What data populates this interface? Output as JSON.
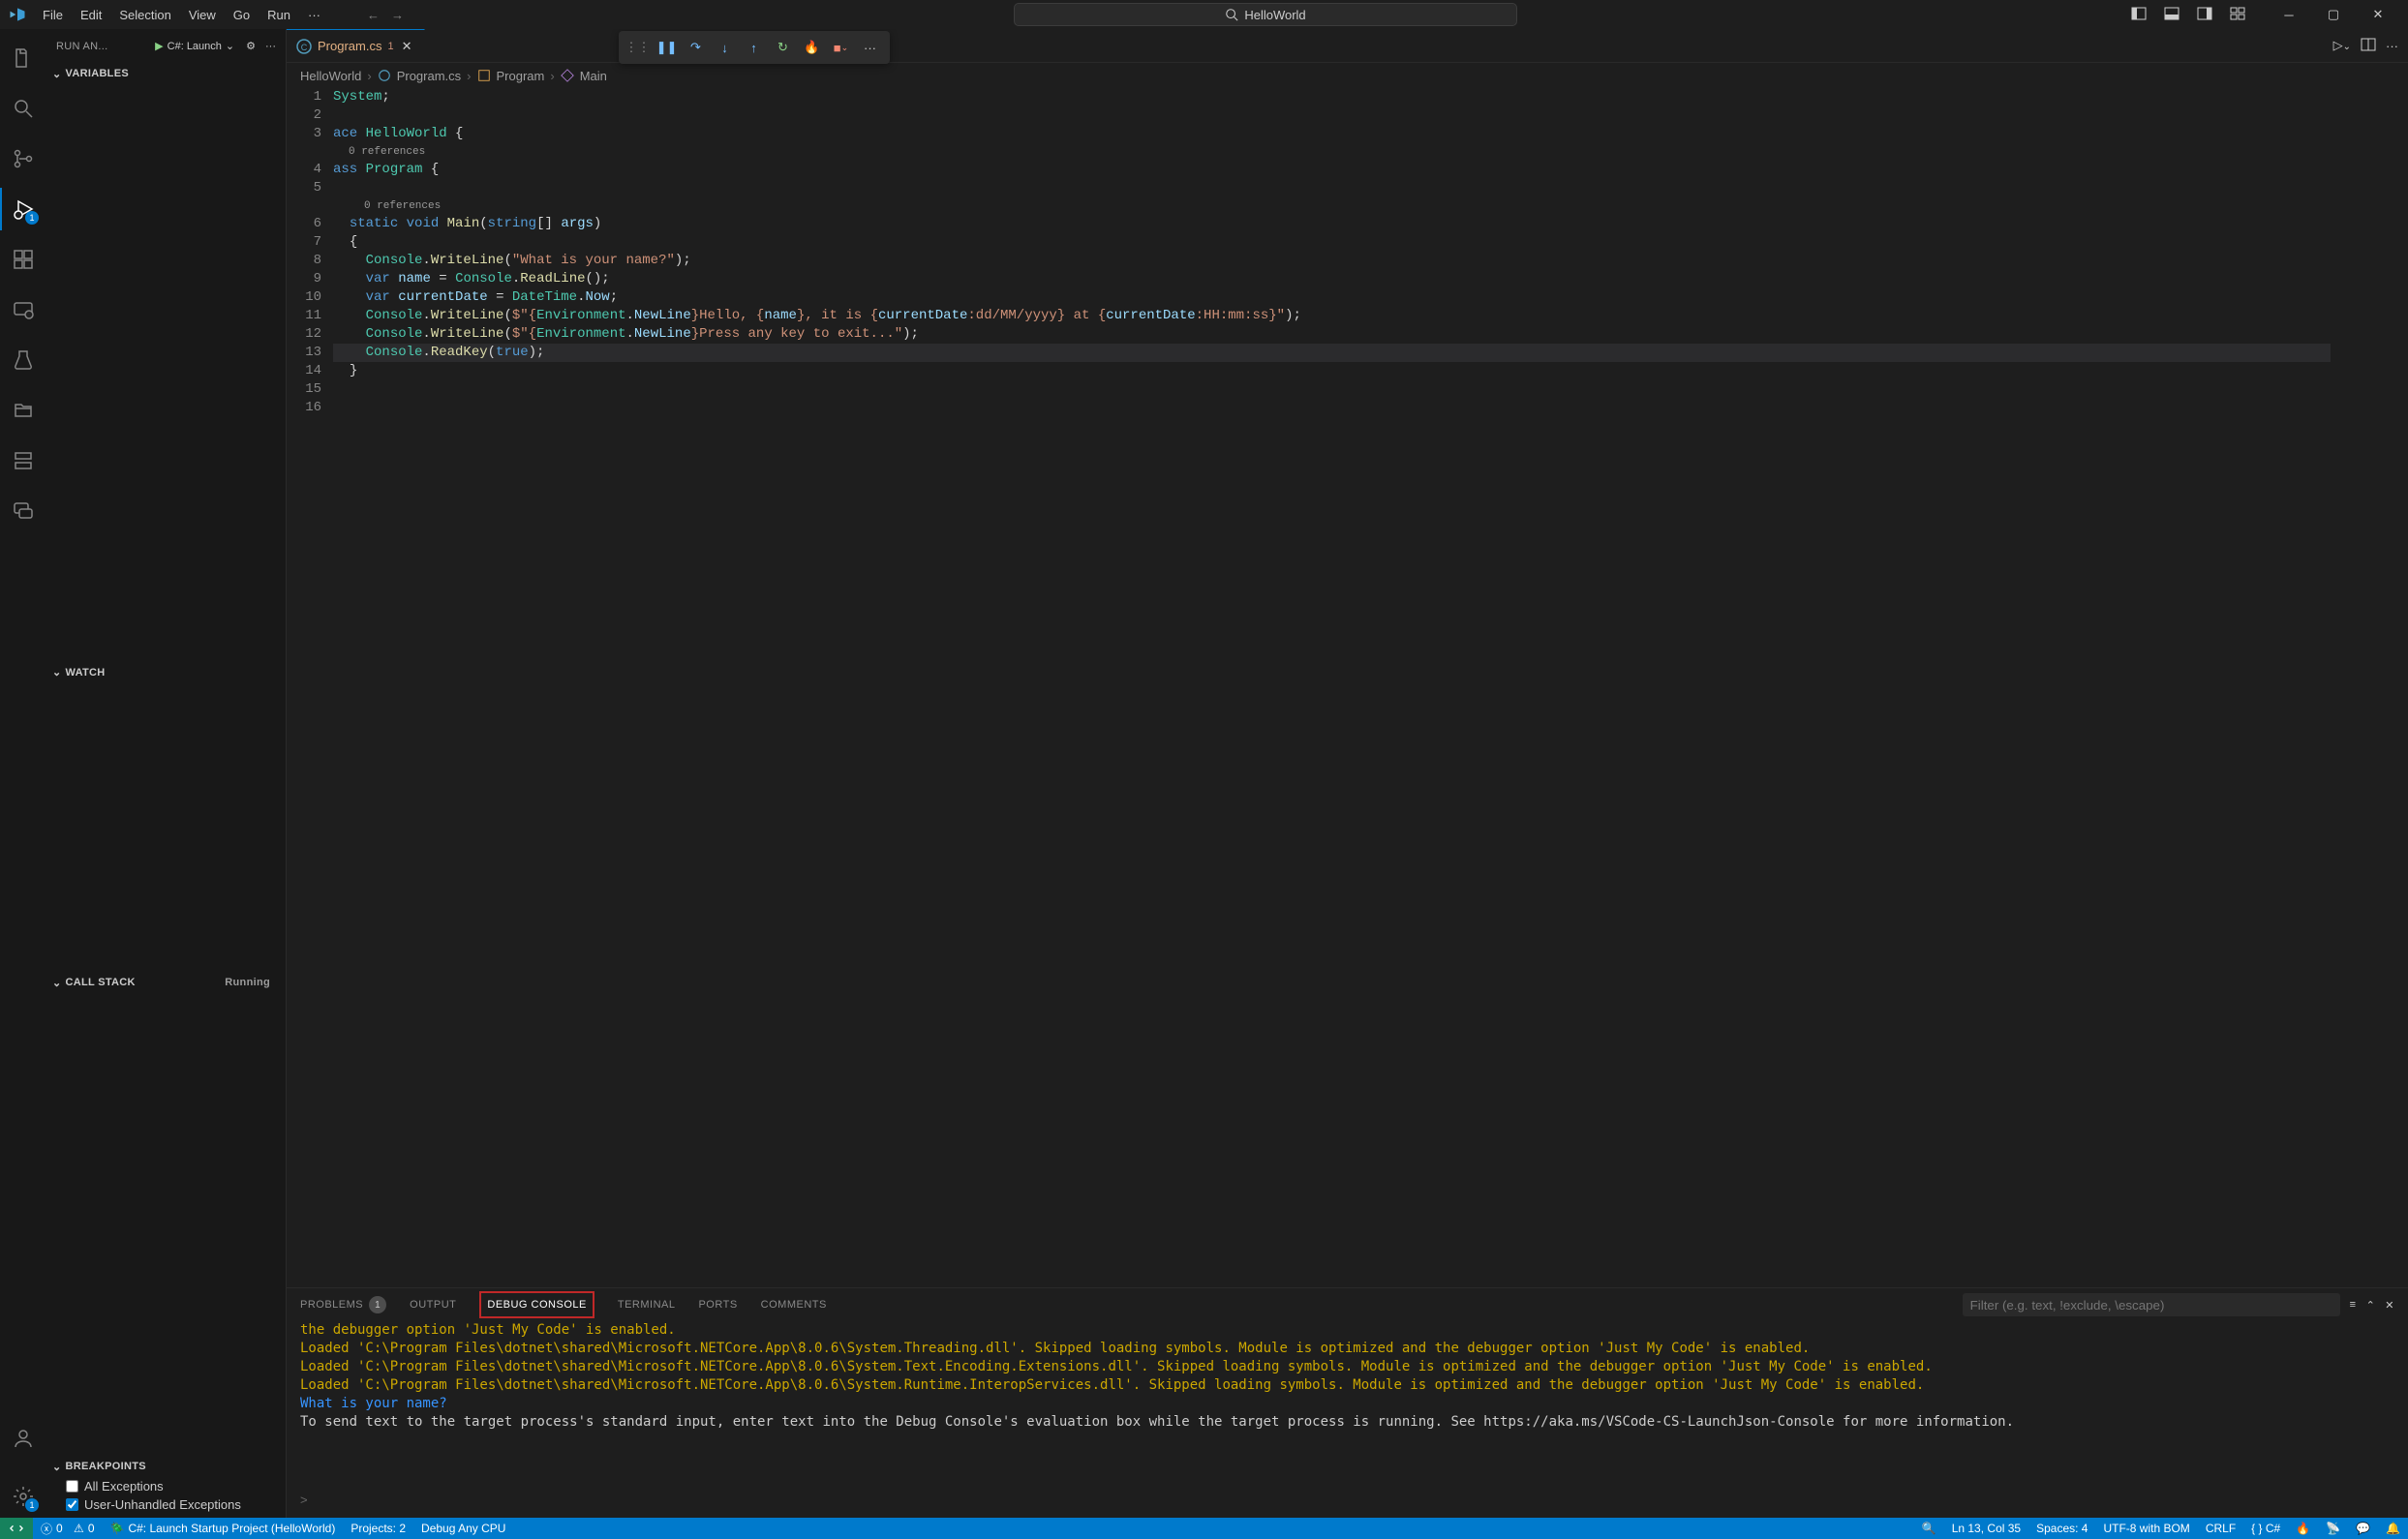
{
  "menu": [
    "File",
    "Edit",
    "Selection",
    "View",
    "Go",
    "Run"
  ],
  "menu_overflow": "···",
  "search": {
    "text": "HelloWorld"
  },
  "sidebar": {
    "title": "RUN AN...",
    "config": "C#: Launch",
    "sections": {
      "variables": "VARIABLES",
      "watch": "WATCH",
      "callstack": "CALL STACK",
      "callstack_status": "Running",
      "breakpoints": "BREAKPOINTS"
    },
    "breakpoints": [
      {
        "label": "All Exceptions",
        "checked": false
      },
      {
        "label": "User-Unhandled Exceptions",
        "checked": true
      }
    ]
  },
  "activity_badge_debug": "1",
  "activity_badge_settings": "1",
  "tab": {
    "label": "Program.cs",
    "modified": "1"
  },
  "breadcrumb": [
    "HelloWorld",
    "Program.cs",
    "Program",
    "Main"
  ],
  "codelens0": "0 references",
  "codelens1": "0 references",
  "code_lines": [
    {
      "n": 1,
      "spans": [
        [
          "tk-type",
          "System"
        ],
        [
          "tk-punc",
          ";"
        ]
      ],
      "indent": 0
    },
    {
      "n": 2,
      "spans": [],
      "indent": 0
    },
    {
      "n": 3,
      "spans": [
        [
          "tk-kw",
          "ace"
        ],
        [
          "",
          " "
        ],
        [
          "tk-type",
          "HelloWorld"
        ],
        [
          "",
          " "
        ],
        [
          "tk-punc",
          "{"
        ]
      ],
      "indent": 0
    },
    {
      "n": 4,
      "spans": [
        [
          "tk-kw",
          "ass"
        ],
        [
          "",
          " "
        ],
        [
          "tk-type",
          "Program"
        ],
        [
          "",
          " "
        ],
        [
          "tk-punc",
          "{"
        ]
      ],
      "indent": 0,
      "lens": "codelens0"
    },
    {
      "n": 5,
      "spans": [],
      "indent": 0
    },
    {
      "n": 6,
      "spans": [
        [
          "tk-kw",
          "static"
        ],
        [
          "",
          " "
        ],
        [
          "tk-kw",
          "void"
        ],
        [
          "",
          " "
        ],
        [
          "tk-fn",
          "Main"
        ],
        [
          "tk-punc",
          "("
        ],
        [
          "tk-kw",
          "string"
        ],
        [
          "tk-punc",
          "[] "
        ],
        [
          "tk-var",
          "args"
        ],
        [
          "tk-punc",
          ")"
        ]
      ],
      "indent": 1,
      "lens": "codelens1"
    },
    {
      "n": 7,
      "spans": [
        [
          "tk-punc",
          "{"
        ]
      ],
      "indent": 1
    },
    {
      "n": 8,
      "spans": [
        [
          "tk-type",
          "Console"
        ],
        [
          "tk-punc",
          "."
        ],
        [
          "tk-fn",
          "WriteLine"
        ],
        [
          "tk-punc",
          "("
        ],
        [
          "tk-str",
          "\"What is your name?\""
        ],
        [
          "tk-punc",
          ");"
        ]
      ],
      "indent": 2
    },
    {
      "n": 9,
      "spans": [
        [
          "tk-kw",
          "var"
        ],
        [
          "",
          " "
        ],
        [
          "tk-var",
          "name"
        ],
        [
          "",
          " "
        ],
        [
          "tk-punc",
          "= "
        ],
        [
          "tk-type",
          "Console"
        ],
        [
          "tk-punc",
          "."
        ],
        [
          "tk-fn",
          "ReadLine"
        ],
        [
          "tk-punc",
          "();"
        ]
      ],
      "indent": 2
    },
    {
      "n": 10,
      "spans": [
        [
          "tk-kw",
          "var"
        ],
        [
          "",
          " "
        ],
        [
          "tk-var",
          "currentDate"
        ],
        [
          "",
          " "
        ],
        [
          "tk-punc",
          "= "
        ],
        [
          "tk-type",
          "DateTime"
        ],
        [
          "tk-punc",
          "."
        ],
        [
          "tk-var",
          "Now"
        ],
        [
          "tk-punc",
          ";"
        ]
      ],
      "indent": 2
    },
    {
      "n": 11,
      "spans": [
        [
          "tk-type",
          "Console"
        ],
        [
          "tk-punc",
          "."
        ],
        [
          "tk-fn",
          "WriteLine"
        ],
        [
          "tk-punc",
          "("
        ],
        [
          "tk-str",
          "$\"{"
        ],
        [
          "tk-type",
          "Environment"
        ],
        [
          "tk-punc",
          "."
        ],
        [
          "tk-var",
          "NewLine"
        ],
        [
          "tk-str",
          "}Hello, {"
        ],
        [
          "tk-var",
          "name"
        ],
        [
          "tk-str",
          "}, it is {"
        ],
        [
          "tk-var",
          "currentDate"
        ],
        [
          "tk-str",
          ":dd/MM/yyyy} at {"
        ],
        [
          "tk-var",
          "currentDate"
        ],
        [
          "tk-str",
          ":HH:mm:ss}\""
        ],
        [
          "tk-punc",
          ");"
        ]
      ],
      "indent": 2
    },
    {
      "n": 12,
      "spans": [
        [
          "tk-type",
          "Console"
        ],
        [
          "tk-punc",
          "."
        ],
        [
          "tk-fn",
          "WriteLine"
        ],
        [
          "tk-punc",
          "("
        ],
        [
          "tk-str",
          "$\"{"
        ],
        [
          "tk-type",
          "Environment"
        ],
        [
          "tk-punc",
          "."
        ],
        [
          "tk-var",
          "NewLine"
        ],
        [
          "tk-str",
          "}Press any key to exit...\""
        ],
        [
          "tk-punc",
          ");"
        ]
      ],
      "indent": 2
    },
    {
      "n": 13,
      "spans": [
        [
          "tk-type",
          "Console"
        ],
        [
          "tk-punc",
          "."
        ],
        [
          "tk-fn",
          "ReadKey"
        ],
        [
          "tk-punc",
          "("
        ],
        [
          "tk-const",
          "true"
        ],
        [
          "tk-punc",
          ");"
        ]
      ],
      "indent": 2,
      "hl": true
    },
    {
      "n": 14,
      "spans": [
        [
          "tk-punc",
          "}"
        ]
      ],
      "indent": 1
    },
    {
      "n": 15,
      "spans": [],
      "indent": 0
    },
    {
      "n": 16,
      "spans": [],
      "indent": 0
    }
  ],
  "panel": {
    "tabs": {
      "problems": "PROBLEMS",
      "problems_badge": "1",
      "output": "OUTPUT",
      "debug_console": "DEBUG CONSOLE",
      "terminal": "TERMINAL",
      "ports": "PORTS",
      "comments": "COMMENTS"
    },
    "filter_placeholder": "Filter (e.g. text, !exclude, \\escape)",
    "lines": [
      {
        "cls": "c-yellow",
        "t": "the debugger option 'Just My Code' is enabled."
      },
      {
        "cls": "c-yellow",
        "t": "Loaded 'C:\\Program Files\\dotnet\\shared\\Microsoft.NETCore.App\\8.0.6\\System.Threading.dll'. Skipped loading symbols. Module is optimized and the debugger option 'Just My Code' is enabled."
      },
      {
        "cls": "c-yellow",
        "t": "Loaded 'C:\\Program Files\\dotnet\\shared\\Microsoft.NETCore.App\\8.0.6\\System.Text.Encoding.Extensions.dll'. Skipped loading symbols. Module is optimized and the debugger option 'Just My Code' is enabled."
      },
      {
        "cls": "c-yellow",
        "t": "Loaded 'C:\\Program Files\\dotnet\\shared\\Microsoft.NETCore.App\\8.0.6\\System.Runtime.InteropServices.dll'. Skipped loading symbols. Module is optimized and the debugger option 'Just My Code' is enabled."
      },
      {
        "cls": "c-cyan",
        "t": "What is your name?"
      },
      {
        "cls": "c-white",
        "t": "To send text to the target process's standard input, enter text into the Debug Console's evaluation box while the target process is running. See https://aka.ms/VSCode-CS-LaunchJson-Console for more information."
      }
    ],
    "input_prompt": ">"
  },
  "status": {
    "errors": "0",
    "warnings": "0",
    "launch": "C#: Launch Startup Project (HelloWorld)",
    "projects": "Projects: 2",
    "build": "Debug Any CPU",
    "ln_col": "Ln 13, Col 35",
    "spaces": "Spaces: 4",
    "encoding": "UTF-8 with BOM",
    "eol": "CRLF",
    "lang": "{ } C#"
  }
}
